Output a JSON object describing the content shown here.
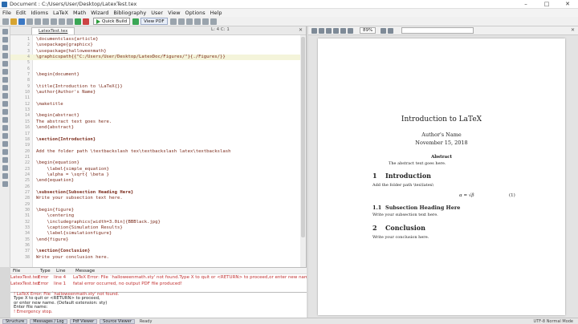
{
  "window": {
    "title": "Document : C:/Users/User/Desktop/LatexTest.tex"
  },
  "menu": [
    "File",
    "Edit",
    "Idioms",
    "LaTeX",
    "Math",
    "Wizard",
    "Bibliography",
    "User",
    "View",
    "Options",
    "Help"
  ],
  "toolbar": {
    "run_label": "Quick Build",
    "view_label": "View PDF"
  },
  "editor": {
    "tab": "LatexTest.tex",
    "position": "L: 4 C: 1",
    "lines": [
      {
        "n": "1",
        "t": "\\documentclass{article}"
      },
      {
        "n": "2",
        "t": "\\usepackage{graphicx}"
      },
      {
        "n": "3",
        "t": "\\usepackage{halloweenmath}"
      },
      {
        "n": "4",
        "t": "\\graphicspath{{\"C:/Users/User/Desktop/LatexDoc/Figures/\"}{./Figures/}}"
      },
      {
        "n": "5",
        "t": ""
      },
      {
        "n": "6",
        "t": ""
      },
      {
        "n": "7",
        "t": "\\begin{document}"
      },
      {
        "n": "8",
        "t": ""
      },
      {
        "n": "9",
        "t": "\\title{Introduction to \\LaTeX{}}"
      },
      {
        "n": "10",
        "t": "\\author{Author's Name}"
      },
      {
        "n": "11",
        "t": ""
      },
      {
        "n": "12",
        "t": "\\maketitle"
      },
      {
        "n": "13",
        "t": ""
      },
      {
        "n": "14",
        "t": "\\begin{abstract}"
      },
      {
        "n": "15",
        "t": "The abstract text goes here."
      },
      {
        "n": "16",
        "t": "\\end{abstract}"
      },
      {
        "n": "17",
        "t": ""
      },
      {
        "n": "18",
        "t": "\\section{Introduction}"
      },
      {
        "n": "19",
        "t": ""
      },
      {
        "n": "20",
        "t": "Add the folder path \\textbackslash tex\\textbackslash latex\\textbackslash"
      },
      {
        "n": "21",
        "t": ""
      },
      {
        "n": "22",
        "t": "\\begin{equation}"
      },
      {
        "n": "23",
        "t": "    \\label{simple_equation}"
      },
      {
        "n": "24",
        "t": "    \\alpha = \\sqrt{ \\beta }"
      },
      {
        "n": "25",
        "t": "\\end{equation}"
      },
      {
        "n": "26",
        "t": ""
      },
      {
        "n": "27",
        "t": "\\subsection{Subsection Heading Here}"
      },
      {
        "n": "28",
        "t": "Write your subsection text here."
      },
      {
        "n": "29",
        "t": ""
      },
      {
        "n": "30",
        "t": "\\begin{figure}"
      },
      {
        "n": "31",
        "t": "    \\centering"
      },
      {
        "n": "32",
        "t": "    \\includegraphics[width=3.0in]{BBBlack.jpg}"
      },
      {
        "n": "33",
        "t": "    \\caption{Simulation Results}"
      },
      {
        "n": "34",
        "t": "    \\label{simulationfigure}"
      },
      {
        "n": "35",
        "t": "\\end{figure}"
      },
      {
        "n": "36",
        "t": ""
      },
      {
        "n": "37",
        "t": "\\section{Conclusion}"
      },
      {
        "n": "38",
        "t": "Write your conclusion here."
      }
    ]
  },
  "messages": {
    "headers": [
      "File",
      "Type",
      "Line",
      "Message"
    ],
    "rows": [
      {
        "file": "LatexTest.tex",
        "type": "Error",
        "line": "line 4",
        "msg": "LaTeX Error: File `halloweenmath.sty' not found.Type X to quit or <RETURN> to proceed,or enter new name. (Defa"
      },
      {
        "file": "LatexTest.tex",
        "type": "Error",
        "line": "line 1",
        "msg": "fatal error occurred, no output PDF file produced!"
      }
    ]
  },
  "log": [
    "! LaTeX Error: File `halloweenmath.sty' not found.",
    "Type X to quit or <RETURN> to proceed,",
    "or enter new name. (Default extension: sty)",
    "Enter file name:",
    "! Emergency stop."
  ],
  "status": {
    "tab1": "Structure",
    "tab2": "Messages / Log",
    "tab3": "Pdf Viewer",
    "tab4": "Source Viewer",
    "ready": "Ready",
    "right": "UTF-8    Normal Mode"
  },
  "pdf": {
    "zoom": "89%",
    "title": "Introduction to LaTeX",
    "author": "Author's Name",
    "date": "November 15, 2018",
    "abstract_head": "Abstract",
    "abstract_text": "The abstract text goes here.",
    "sec1_num": "1",
    "sec1": "Introduction",
    "sec1_body": "Add the folder path \\tex\\latex\\",
    "eq": "α = √β",
    "eq_num": "(1)",
    "sub_num": "1.1",
    "sub": "Subsection Heading Here",
    "sub_body": "Write your subsection text here.",
    "sec2_num": "2",
    "sec2": "Conclusion",
    "sec2_body": "Write your conclusion here."
  }
}
